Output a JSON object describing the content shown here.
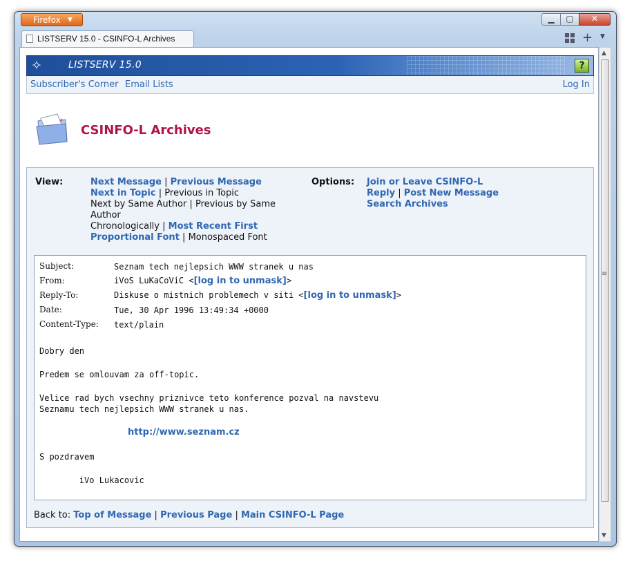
{
  "browser": {
    "menu_button": "Firefox",
    "tab_title": "LISTSERV 15.0 - CSINFO-L Archives"
  },
  "header": {
    "product": "LISTSERV 15.0",
    "help": "?"
  },
  "nav": {
    "subscribers_corner": "Subscriber's Corner",
    "email_lists": "Email Lists",
    "log_in": "Log In"
  },
  "page_title": "CSINFO-L Archives",
  "view": {
    "label": "View:",
    "next_message": "Next Message",
    "previous_message": "Previous Message",
    "next_in_topic": "Next in Topic",
    "previous_in_topic": "Previous in Topic",
    "next_by_same_author": "Next by Same Author",
    "previous_by_same_author_1": "Previous by Same",
    "previous_by_same_author_2": "Author",
    "chronologically": "Chronologically",
    "most_recent_first": "Most Recent First",
    "proportional_font": "Proportional Font",
    "monospaced_font": "Monospaced Font"
  },
  "options": {
    "label": "Options:",
    "join_or_leave": "Join or Leave CSINFO-L",
    "reply": "Reply",
    "post_new_message": "Post New Message",
    "search_archives": "Search Archives"
  },
  "message": {
    "subject_label": "Subject:",
    "subject": "Seznam tech nejlepsich WWW stranek u nas",
    "from_label": "From:",
    "from_name": "iVoS LuKaCoViC <",
    "from_mask": "[log in to unmask]",
    "from_end": ">",
    "replyto_label": "Reply-To:",
    "replyto_name": "Diskuse o mistnich problemech v siti <",
    "replyto_mask": "[log in to unmask]",
    "replyto_end": ">",
    "date_label": "Date:",
    "date": "Tue, 30 Apr 1996 13:49:34 +0000",
    "content_type_label": "Content-Type:",
    "content_type": "text/plain",
    "body": {
      "greeting": "Dobry den",
      "apology": "Predem se omlouvam za off-topic.",
      "line1": "Velice rad bych vsechny priznivce teto konference pozval na navstevu",
      "line2": "Seznamu tech nejlepsich WWW stranek u nas.",
      "link": "http://www.seznam.cz",
      "closing": "S pozdravem",
      "signature": "        iVo Lukacovic"
    }
  },
  "back": {
    "label": "Back to:",
    "top_of_message": "Top of Message",
    "previous_page": "Previous Page",
    "main_page": "Main CSINFO-L Page"
  },
  "separator": "|"
}
